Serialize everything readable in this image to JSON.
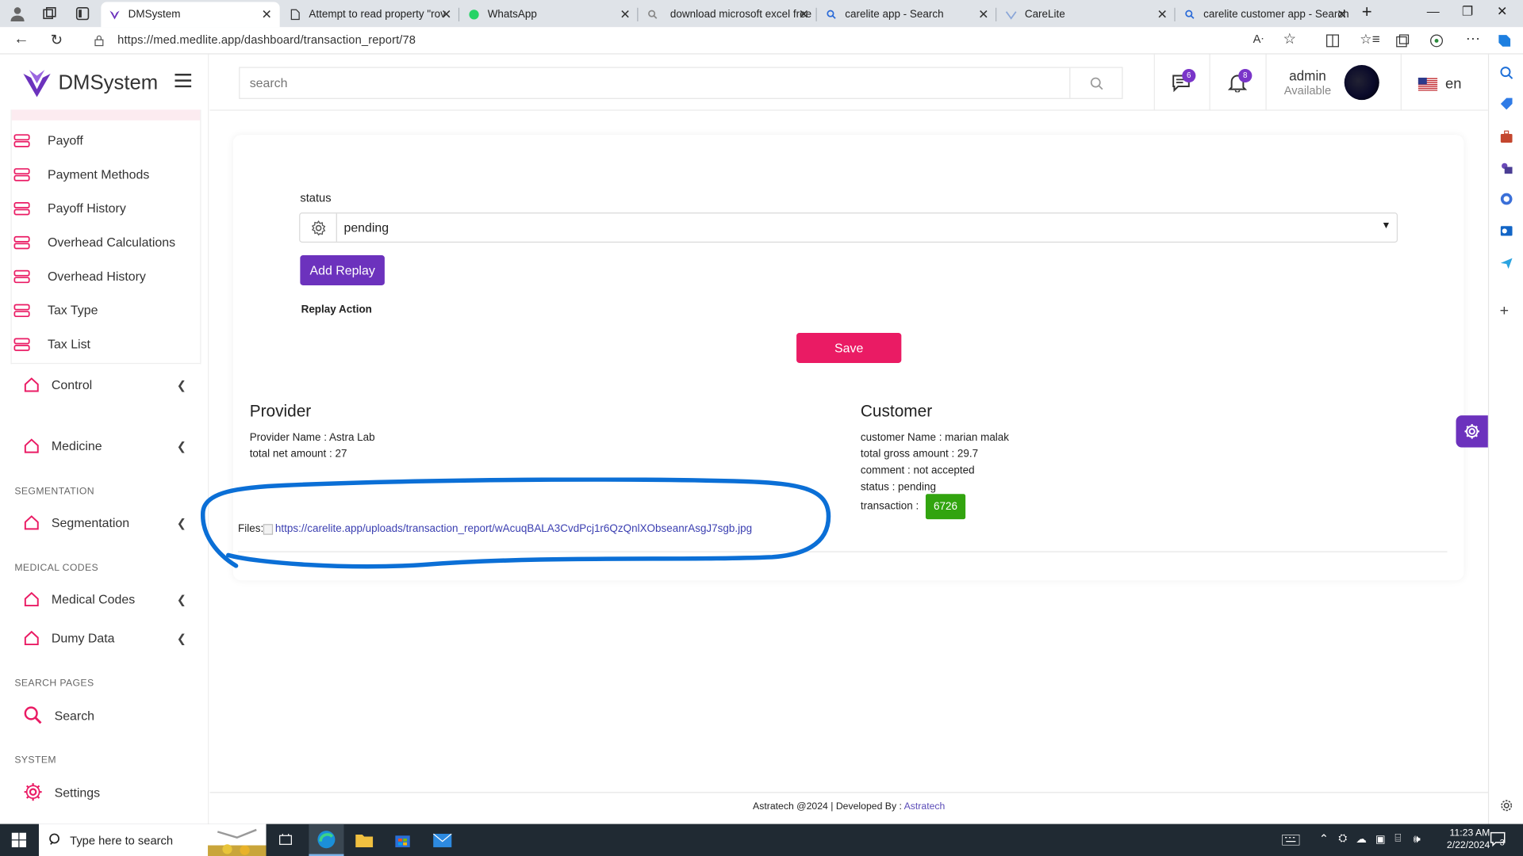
{
  "browser": {
    "tabs": [
      {
        "title": "DMSystem",
        "active": true
      },
      {
        "title": "Attempt to read property \"rov"
      },
      {
        "title": "WhatsApp"
      },
      {
        "title": "download microsoft excel free"
      },
      {
        "title": "carelite app - Search"
      },
      {
        "title": "CareLite"
      },
      {
        "title": "carelite customer app - Search"
      }
    ],
    "url": "https://med.medlite.app/dashboard/transaction_report/78"
  },
  "brand": {
    "name": "DMSystem"
  },
  "sidebar": {
    "sub_items": [
      "Payoff",
      "Payment Methods",
      "Payoff History",
      "Overhead Calculations",
      "Overhead History",
      "Tax Type",
      "Tax List"
    ],
    "nav": {
      "control": "Control",
      "medicine": "Medicine",
      "segmentation": "Segmentation",
      "medical_codes": "Medical Codes",
      "dumy_data": "Dumy Data",
      "search": "Search",
      "settings": "Settings"
    },
    "sections": {
      "segmentation": "SEGMENTATION",
      "medical_codes": "MEDICAL CODES",
      "search_pages": "SEARCH PAGES",
      "system": "SYSTEM"
    }
  },
  "topbar": {
    "search_placeholder": "search",
    "messages_count": "6",
    "notifications_count": "8",
    "user_name": "admin",
    "user_status": "Available",
    "language": "en"
  },
  "form": {
    "status_label": "status",
    "status_value": "pending",
    "add_replay_label": "Add Replay",
    "replay_action_label": "Replay Action",
    "save_label": "Save"
  },
  "provider": {
    "heading": "Provider",
    "name_line": "Provider Name : Astra Lab",
    "net_line": "total net amount : 27"
  },
  "customer": {
    "heading": "Customer",
    "name_line": "customer Name : marian malak",
    "gross_line": "total gross amount : 29.7",
    "comment_line": "comment : not accepted",
    "status_line": "status : pending",
    "transaction_label": "transaction :",
    "transaction_id": "6726"
  },
  "files": {
    "label": "Files:",
    "link": "https://carelite.app/uploads/transaction_report/wAcuqBALA3CvdPcj1r6QzQnlXObseanrAsgJ7sgb.jpg"
  },
  "footer": {
    "text": "Astratech @2024 | Developed By :",
    "link": "Astratech"
  },
  "taskbar": {
    "search_placeholder": "Type here to search",
    "time": "11:23 AM",
    "date": "2/22/2024",
    "notifications": "3"
  },
  "colors": {
    "brand_purple": "#6c32bd",
    "save_pink": "#ea1b64",
    "badge_green": "#32a40f",
    "annotation_blue": "#0b6fd6"
  }
}
